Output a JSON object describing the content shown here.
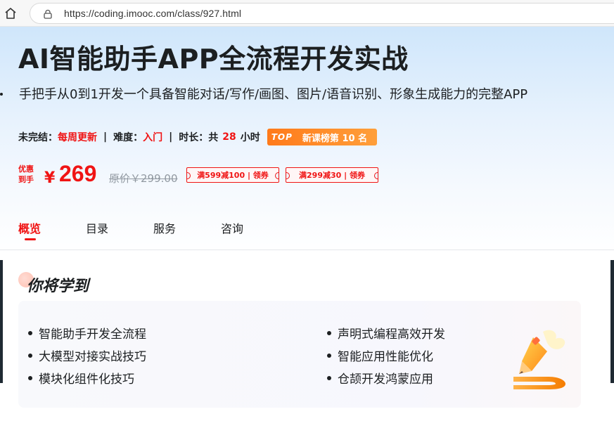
{
  "browser": {
    "url": "https://coding.imooc.com/class/927.html"
  },
  "course": {
    "title": "AI智能助手APP全流程开发实战",
    "subtitle": "手把手从0到1开发一个具备智能对话/写作/画图、图片/语音识别、形象生成能力的完整APP"
  },
  "meta": {
    "status_label": "未完结：",
    "status_value": "每周更新",
    "difficulty_label": "难度：",
    "difficulty_value": "入门",
    "duration_label": "时长：",
    "duration_prefix": "共",
    "duration_value": "28",
    "duration_unit": "小时",
    "separator": "|",
    "rank_tag": "TOP",
    "rank_text": "新课榜第 10 名"
  },
  "price": {
    "promo_line1": "优惠",
    "promo_line2": "到手",
    "currency": "¥",
    "current": "269",
    "original": "原价￥299.00",
    "coupons": [
      "满599减100 | 领券",
      "满299减30 | 领券"
    ]
  },
  "tabs": [
    {
      "label": "概览",
      "active": true
    },
    {
      "label": "目录",
      "active": false
    },
    {
      "label": "服务",
      "active": false
    },
    {
      "label": "咨询",
      "active": false
    }
  ],
  "learn": {
    "title": "你将学到",
    "items": [
      "智能助手开发全流程",
      "大模型对接实战技巧",
      "模块化组件化技巧",
      "声明式编程高效开发",
      "智能应用性能优化",
      "仓颉开发鸿蒙应用"
    ]
  },
  "colors": {
    "accent_red": "#f01414",
    "rank_orange": "#ff8a2a",
    "hero_blue": "#cfe6fb"
  }
}
